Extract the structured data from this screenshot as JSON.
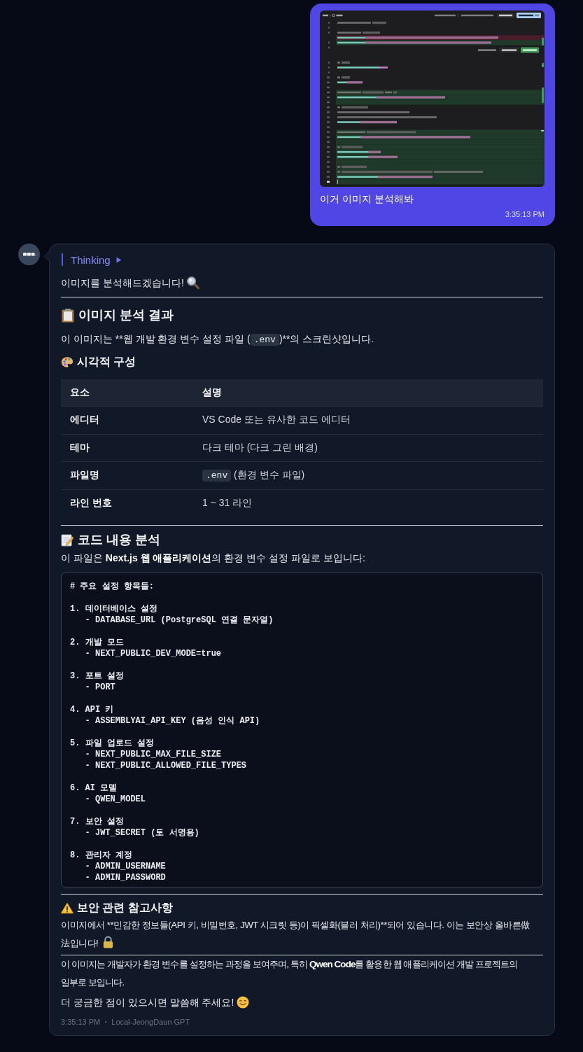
{
  "user_message": {
    "text": "이거 이미지 분석해봐",
    "time": "3:35:13 PM"
  },
  "assistant_message": {
    "thinking": {
      "label": "Thinking",
      "expanded": false
    },
    "greeting": "이미지를 분석해드겠습니다!",
    "analysis": {
      "title": "이미지 분석 결과",
      "intro": [
        {
          "kind": "text",
          "text": "이 이미지는 **웹 개발 환경 변수 설정 파일 ("
        },
        {
          "kind": "code",
          "text": ".env"
        },
        {
          "kind": "text",
          "text": ")**의 스크린샷입니다."
        }
      ],
      "visual": {
        "title": "시각적 구성",
        "columns": [
          "요소",
          "설명"
        ],
        "rows": [
          {
            "label": "에디터",
            "value": [
              {
                "kind": "text",
                "text": "VS Code 또는 유사한 코드 에디터"
              }
            ]
          },
          {
            "label": "테마",
            "value": [
              {
                "kind": "text",
                "text": "다크 테마 (다크 그린 배경)"
              }
            ]
          },
          {
            "label": "파일명",
            "value": [
              {
                "kind": "code",
                "text": ".env"
              },
              {
                "kind": "text",
                "text": " (환경 변수 파일)"
              }
            ]
          },
          {
            "label": "라인 번호",
            "value": [
              {
                "kind": "text",
                "text": "1 ~ 31 라인"
              }
            ]
          }
        ]
      }
    },
    "code_analysis": {
      "title": "코드 내용 분석",
      "intro": "이 파일은 **Next.js 웹 애플리케이션**의 환경 변수 설정 파일로 보입니다:",
      "code": "# 주요 설정 항목들:\n\n1. 데이터베이스 설정\n   - DATABASE_URL (PostgreSQL 연결 문자열)\n\n2. 개발 모드\n   - NEXT_PUBLIC_DEV_MODE=true\n\n3. 포트 설정\n   - PORT\n\n4. API 키\n   - ASSEMBLYAI_API_KEY (음성 인식 API)\n\n5. 파일 업로드 설정\n   - NEXT_PUBLIC_MAX_FILE_SIZE\n   - NEXT_PUBLIC_ALLOWED_FILE_TYPES\n\n6. AI 모델\n   - QWEN_MODEL\n\n7. 보안 설정\n   - JWT_SECRET (토 서명용)\n\n8. 관리자 계정\n   - ADMIN_USERNAME\n   - ADMIN_PASSWORD"
    },
    "security": {
      "title": "보안 관련 참고사항",
      "lines": [
        "이미지에서 **민감한 정보들(API 키, 비밀번호, JWT 시크릿 등)이 픽셀화(블러 처리)**되어 있습니다. 이는 보안상 올바른做",
        "法입니다!"
      ]
    },
    "summary": "이 이미지는 개발자가 환경 변수를 설정하는 과정을 보여주며, 특히 **Qwen Code**를 활용한 웹 애플리케이션 개발 프로젝트의 일부로 보입니다.",
    "closing": "더 궁금한 점이 있으시면 말씀해 주세요!",
    "footer": {
      "time": "3:35:13 PM",
      "model": "Local-JeongDaun GPT"
    }
  }
}
